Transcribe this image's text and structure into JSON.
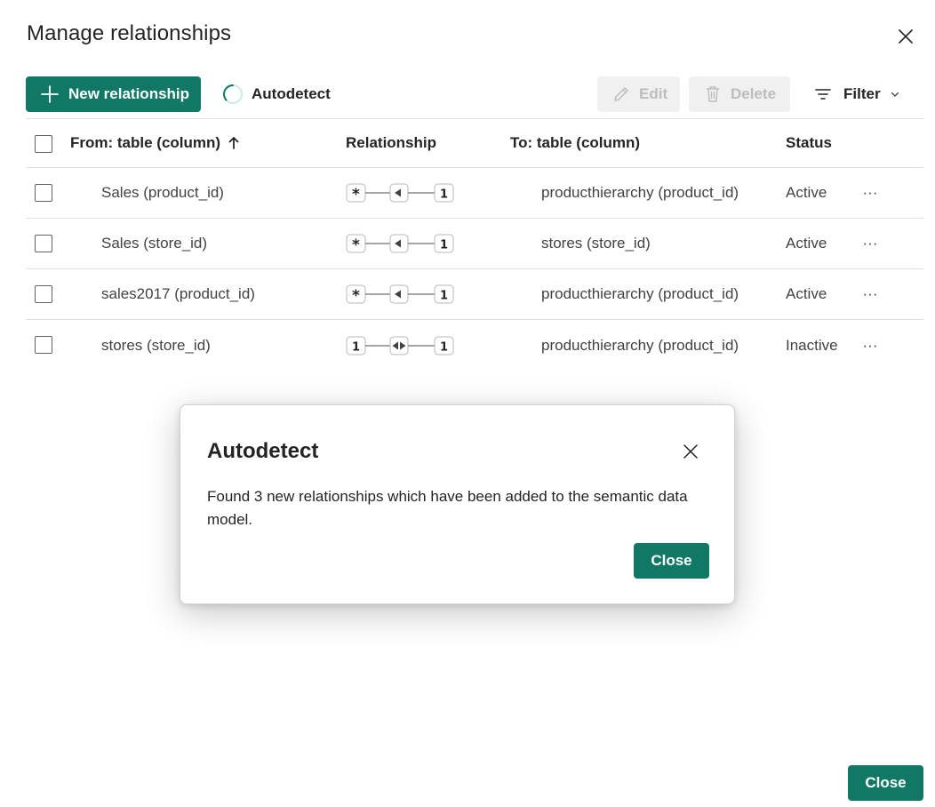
{
  "window": {
    "title": "Manage relationships"
  },
  "toolbar": {
    "new_relationship_label": "New relationship",
    "autodetect_label": "Autodetect",
    "edit_label": "Edit",
    "delete_label": "Delete",
    "filter_label": "Filter"
  },
  "table": {
    "headers": {
      "from": "From: table (column)",
      "relationship": "Relationship",
      "to": "To: table (column)",
      "status": "Status"
    },
    "sort": "ascending on From",
    "rows": [
      {
        "from": "Sales (product_id)",
        "left_card": "*",
        "cross_filter": "single",
        "right_card": "1",
        "to": "producthierarchy (product_id)",
        "status": "Active"
      },
      {
        "from": "Sales (store_id)",
        "left_card": "*",
        "cross_filter": "single",
        "right_card": "1",
        "to": "stores (store_id)",
        "status": "Active"
      },
      {
        "from": "sales2017 (product_id)",
        "left_card": "*",
        "cross_filter": "single",
        "right_card": "1",
        "to": "producthierarchy (product_id)",
        "status": "Active"
      },
      {
        "from": "stores (store_id)",
        "left_card": "1",
        "cross_filter": "both",
        "right_card": "1",
        "to": "producthierarchy (product_id)",
        "status": "Inactive"
      }
    ],
    "more_label": "···"
  },
  "dialog": {
    "title": "Autodetect",
    "message": "Found 3 new relationships which have been added to the semantic data model.",
    "close_label": "Close"
  },
  "footer": {
    "close_label": "Close"
  },
  "colors": {
    "accent": "#117865",
    "disabled_bg": "#f0f0f0",
    "disabled_text": "#bdbdbd",
    "border": "#e0e0e0"
  }
}
